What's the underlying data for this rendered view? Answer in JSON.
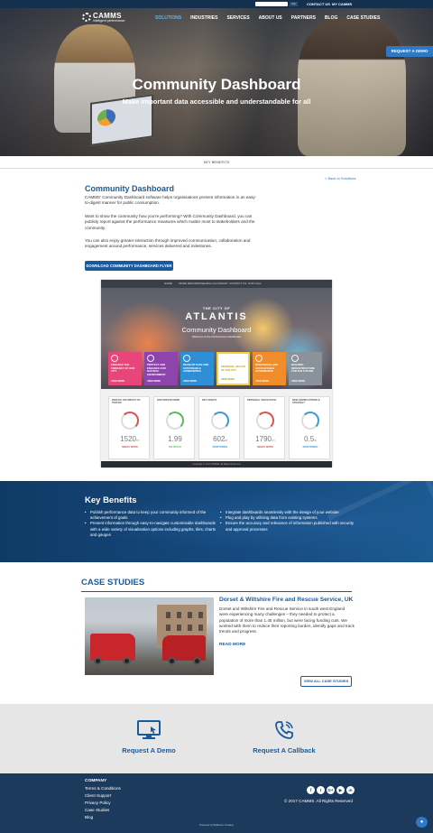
{
  "colors": {
    "brand_dark": "#13304f",
    "brand_blue": "#1a5a9c",
    "accent": "#2f78c4",
    "nav_active": "#5cb8e6"
  },
  "topbar": {
    "search_button": "Go",
    "contact": "CONTACT US",
    "account": "MY CAMMS"
  },
  "header": {
    "logo_name": "CAMMS",
    "logo_tagline": "intelligent performance",
    "nav": [
      "SOLUTIONS",
      "INDUSTRIES",
      "SERVICES",
      "ABOUT US",
      "PARTNERS",
      "BLOG",
      "CASE STUDIES"
    ],
    "demo_tab": "REQUEST A DEMO"
  },
  "hero": {
    "title": "Community Dashboard",
    "subtitle": "Make important data accessible and understandable for all"
  },
  "subnav": {
    "key_benefits": "KEY BENEFITS"
  },
  "content": {
    "back_link": "< Back to Solutions",
    "heading": "Community Dashboard",
    "paragraphs": [
      "CAMMS' Community Dashboard software helps organisations present information in an easy-to-digest manner for public consumption.",
      "Want to show the community how you're performing? With Community Dashboard, you can publicly report against the performance measures which matter most to stakeholders and the community.",
      "You can also enjoy greater interaction through improved communication, collaboration and engagement around performance, services delivered and milestones."
    ],
    "download_button": "DOWNLOAD COMMUNITY DASHBOARD FLYER"
  },
  "dashboard_preview": {
    "nav": [
      "HOME",
      "MORE RECORDS",
      "SEARCH GLOSSARY",
      "CONTACT US",
      "OUR CALL"
    ],
    "city_label": "THE CITY OF",
    "city_name": "ATLANTIS",
    "title": "Community Dashboard",
    "welcome": "Welcome to the Performance Dashboard",
    "tiles": [
      {
        "label": "ENHANCE THE VIBRANCY OF OUR CITY",
        "color": "#e8457a",
        "link": "VIEW MORE"
      },
      {
        "label": "PROTECT AND ENHANCE OUR NATURAL ENVIRONMENT",
        "color": "#8e44ad",
        "link": "VIEW MORE"
      },
      {
        "label": "DEVELOP SAFE AND SUSTAINABLE COMMUNITIES",
        "color": "#2f8fd6",
        "link": "VIEW MORE"
      },
      {
        "label": "FINANCIAL HEALTH OF THE CITY",
        "color": "#f4d03f",
        "link": "VIEW MORE"
      },
      {
        "label": "RESPONSIVE AND ACCOUNTABLE GOVERNANCE",
        "color": "#f08c2a",
        "link": "VIEW MORE"
      },
      {
        "label": "BUILDING INFRASTRUCTURE FOR THE FUTURE",
        "color": "#8a939c",
        "link": "VIEW MORE"
      }
    ],
    "cards": [
      {
        "title": "REDUCE THE IMPACT OF TRAFFIC",
        "value": "1520",
        "unit": "/Yr",
        "status": "NEEDS WORK",
        "ring": "#d9534f"
      },
      {
        "title": "PARTICIPATE MORE",
        "value": "1.99",
        "unit": "",
        "status": "ON TRACK",
        "ring": "#5cb85c"
      },
      {
        "title": "NET ASSETS",
        "value": "602",
        "unit": "M",
        "status": "MONITORING",
        "ring": "#3a9ad9"
      },
      {
        "title": "PERSONAL SPACE RATIO",
        "value": "1790",
        "unit": "/Yr",
        "status": "NEEDS WORK",
        "ring": "#d9534f"
      },
      {
        "title": "NEW GROWTH PROFILE STRATEGY",
        "value": "0.5",
        "unit": "%",
        "status": "MONITORING",
        "ring": "#3a9ad9"
      }
    ],
    "footer": "Copyright © 2017 CAMMS. All Rights Reserved"
  },
  "key_benefits": {
    "title": "Key Benefits",
    "left": [
      "Publish performance data to keep your community informed of the achievement of goals",
      "Present information through easy-to-navigate customisable dashboards with a wide variety of visualisation options including graphs, tiles, charts and gauges"
    ],
    "right": [
      "Integrate dashboards seamlessly with the design of your website",
      "Plug and play by utilising data from existing systems",
      "Ensure the accuracy and relevance of information published with security and approval processes"
    ]
  },
  "case_studies": {
    "title": "CASE STUDIES",
    "heading": "Dorset & Wiltshire Fire and Rescue Service, UK",
    "text": "Dorset and Wiltshire Fire and Rescue Service in south west England were experiencing many challenges – they needed to protect a population of more than 1.45 million, but were facing funding cuts. We worked with them to reduce their reporting burden, identify gaps and track trends and progress.",
    "read_more": "READ MORE",
    "view_all": "VIEW ALL CASE STUDIES"
  },
  "cta": {
    "demo_label": "Request A Demo",
    "demo_icon": "monitor-icon",
    "callback_label": "Request A Callback",
    "callback_icon": "phone-icon"
  },
  "footer": {
    "company_title": "COMPANY",
    "links": [
      "Terms & Conditions",
      "Client Support",
      "Privacy Policy",
      "Case Studies",
      "Blog"
    ],
    "social": [
      "f",
      "t",
      "G+",
      "▶",
      "in"
    ],
    "copyright": "© 2017 CAMMS. All Rights Reserved",
    "powered": "Powered by Brilliance Creative"
  }
}
